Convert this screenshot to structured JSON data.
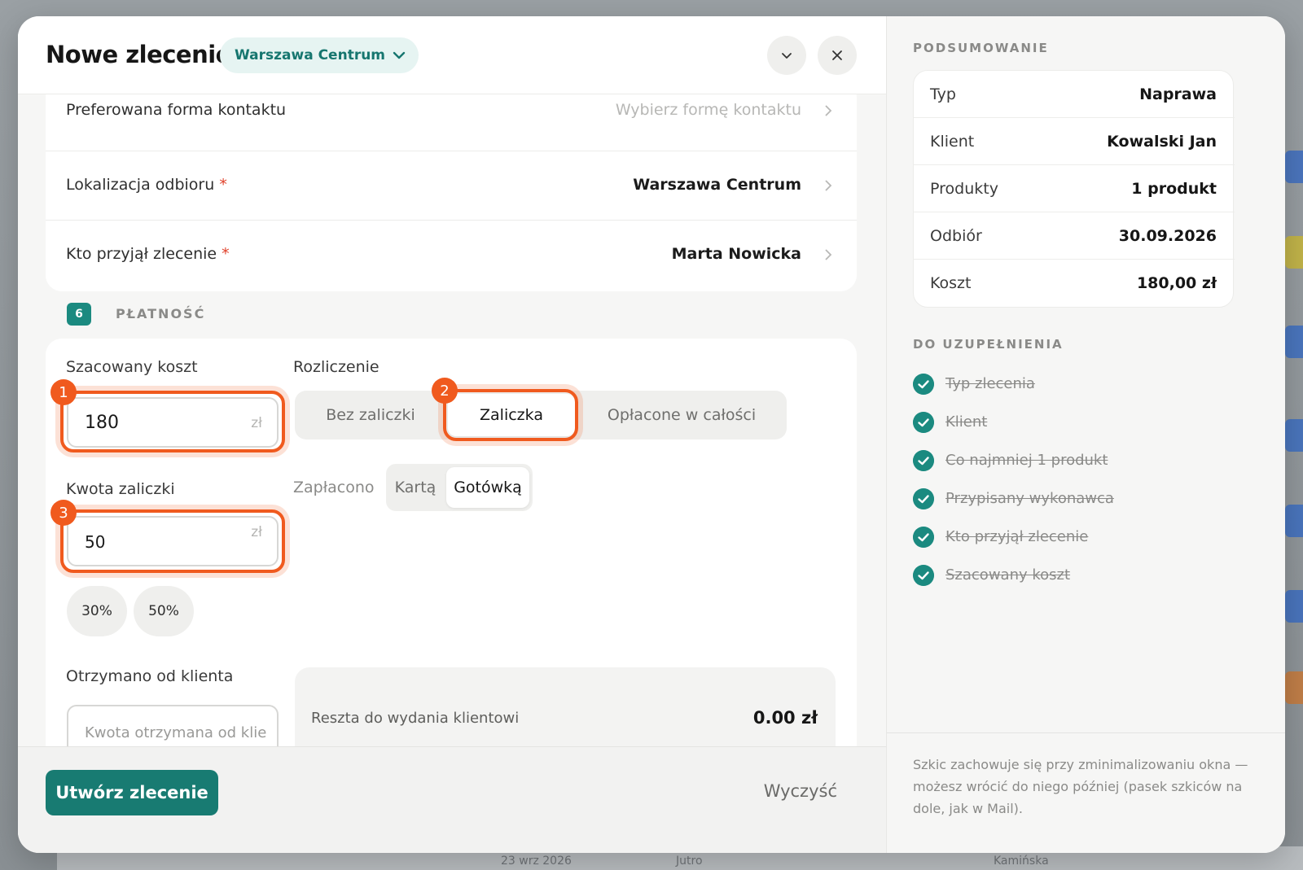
{
  "header": {
    "title": "Nowe zlecenie",
    "location_pill": "Warszawa Centrum"
  },
  "rows": [
    {
      "label": "Preferowana forma kontaktu",
      "required": false,
      "value": "Wybierz formę kontaktu",
      "placeholder": true
    },
    {
      "label": "Lokalizacja odbioru",
      "required": true,
      "value": "Warszawa Centrum",
      "placeholder": false
    },
    {
      "label": "Kto przyjął zlecenie",
      "required": true,
      "value": "Marta Nowicka",
      "placeholder": false
    }
  ],
  "payment": {
    "section_number": "6",
    "section_title": "PŁATNOŚĆ",
    "estimated_cost_label": "Szacowany koszt",
    "estimated_cost_value": "180",
    "currency": "zł",
    "settlement_label": "Rozliczenie",
    "settlement_options": [
      "Bez zaliczki",
      "Zaliczka",
      "Opłacone w całości"
    ],
    "settlement_selected": "Zaliczka",
    "advance_label": "Kwota zaliczki",
    "advance_value": "50",
    "paid_label": "Zapłacono",
    "paid_options": [
      "Kartą",
      "Gotówką"
    ],
    "paid_selected": "Gotówką",
    "percent_buttons": [
      "30%",
      "50%"
    ],
    "received_label": "Otrzymano od klienta",
    "received_placeholder": "Kwota otrzymana od klie",
    "change_label": "Reszta do wydania klientowi",
    "change_value": "0.00 zł"
  },
  "highlights": [
    "1",
    "2",
    "3"
  ],
  "footer": {
    "create_label": "Utwórz zlecenie",
    "clear_label": "Wyczyść"
  },
  "summary": {
    "section_title": "PODSUMOWANIE",
    "rows": [
      {
        "k": "Typ",
        "v": "Naprawa"
      },
      {
        "k": "Klient",
        "v": "Kowalski Jan"
      },
      {
        "k": "Produkty",
        "v": "1 produkt"
      },
      {
        "k": "Odbiór",
        "v": "30.09.2026"
      },
      {
        "k": "Koszt",
        "v": "180,00 zł"
      }
    ]
  },
  "todo": {
    "section_title": "DO UZUPEŁNIENIA",
    "items": [
      "Typ zlecenia",
      "Klient",
      "Co najmniej 1 produkt",
      "Przypisany wykonawca",
      "Kto przyjął zlecenie",
      "Szacowany koszt"
    ]
  },
  "note": "Szkic zachowuje się przy zminimalizowaniu okna — możesz wrócić do niego później (pasek szkiców na dole, jak w Mail).",
  "background": {
    "bottom_texts": [
      "23 wrz 2026",
      "Jutro",
      "Kamińska"
    ]
  },
  "colors": {
    "accent": "#187b72",
    "highlight": "#f05a1e",
    "required": "#e0412a"
  }
}
